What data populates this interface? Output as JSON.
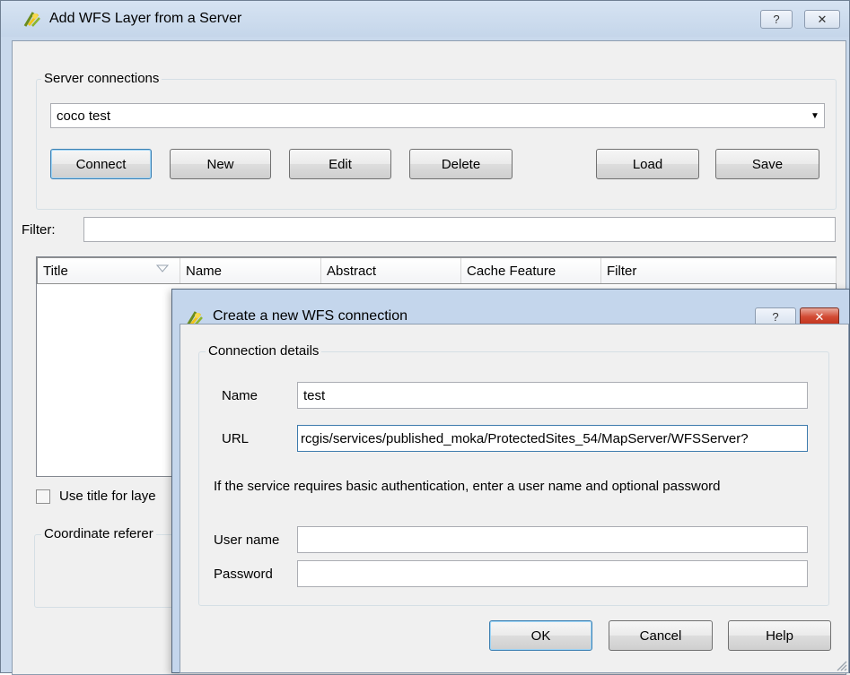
{
  "main": {
    "title": "Add WFS Layer from a Server",
    "caption_help": "?",
    "caption_close": "✕",
    "server_group_title": "Server connections",
    "server_selected": "coco test",
    "buttons": {
      "connect": "Connect",
      "new": "New",
      "edit": "Edit",
      "delete": "Delete",
      "load": "Load",
      "save": "Save"
    },
    "filter_label": "Filter:",
    "filter_value": "",
    "table_headers": [
      "Title",
      "Name",
      "Abstract",
      "Cache Feature",
      "Filter"
    ],
    "use_title_label": "Use title for laye",
    "crs_group_title": "Coordinate referer"
  },
  "dialog": {
    "title": "Create a new WFS connection",
    "caption_help": "?",
    "caption_close": "✕",
    "group_title": "Connection details",
    "name_label": "Name",
    "name_value": "test",
    "url_label": "URL",
    "url_value": "rcgis/services/published_moka/ProtectedSites_54/MapServer/WFSServer?",
    "auth_note": "If the service requires basic authentication, enter a user name and optional password",
    "username_label": "User name",
    "username_value": "",
    "password_label": "Password",
    "password_value": "",
    "buttons": {
      "ok": "OK",
      "cancel": "Cancel",
      "help": "Help"
    }
  },
  "icons": {
    "app_icon": "qgis-logo-icon",
    "dropdown": "chevron-down-icon",
    "sort": "sort-indicator-icon",
    "resize": "resize-grip-icon"
  },
  "colors": {
    "titlebar": "#c9d9ec",
    "client": "#f0f0f0",
    "close_red": "#c0311b"
  }
}
